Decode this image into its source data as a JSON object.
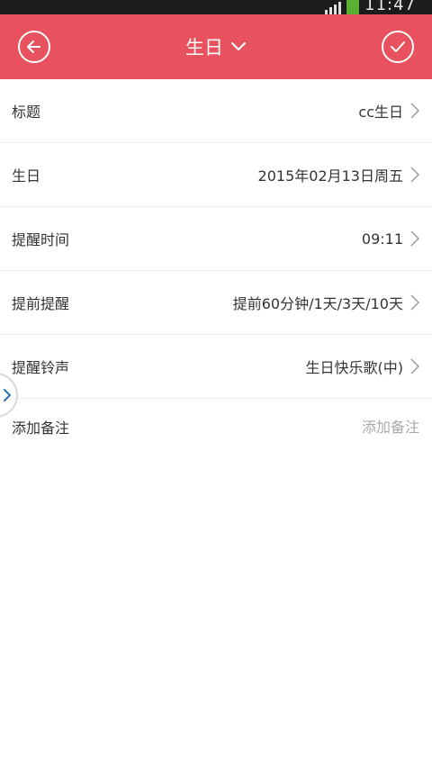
{
  "status_bar": {
    "time": "11:47"
  },
  "header": {
    "title": "生日"
  },
  "colors": {
    "accent": "#e8515e",
    "status_bar": "#1c1c1c",
    "battery": "#5ab030"
  },
  "form": {
    "rows": [
      {
        "label": "标题",
        "value": "cc生日"
      },
      {
        "label": "生日",
        "value": "2015年02月13日周五"
      },
      {
        "label": "提醒时间",
        "value": "09:11"
      },
      {
        "label": "提前提醒",
        "value": "提前60分钟/1天/3天/10天"
      },
      {
        "label": "提醒铃声",
        "value": "生日快乐歌(中)"
      }
    ],
    "note": {
      "label": "添加备注",
      "placeholder": "添加备注"
    }
  },
  "icons": {
    "back": "arrow-left-circle-icon",
    "confirm": "check-circle-icon",
    "title_dropdown": "chevron-down-icon",
    "row_arrow": "chevron-right-icon",
    "side_handle": "chevron-right-icon"
  }
}
